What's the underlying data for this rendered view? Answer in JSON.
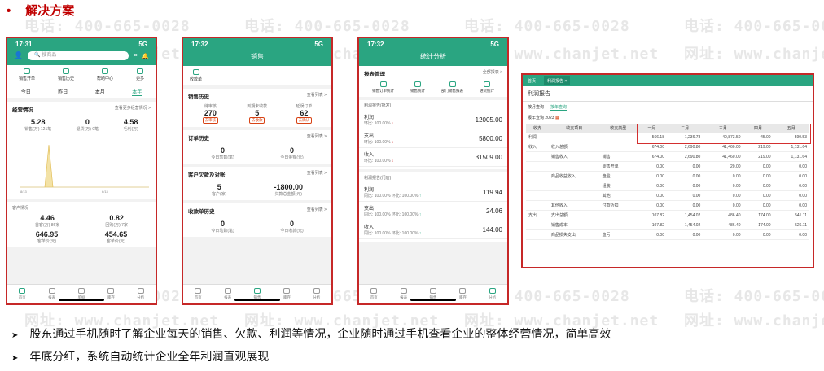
{
  "title": "解决方案",
  "bullets": [
    "股东通过手机随时了解企业每天的销售、欠款、利润等情况，企业随时通过手机查看企业的整体经营情况，简单高效",
    "年底分红，系统自动统计企业全年利润直观展现"
  ],
  "watermark": {
    "phone": "电话: 400-665-0028",
    "site": "网址: www.chanjet.net"
  },
  "p1": {
    "time": "17:31",
    "signal": "5G",
    "search": "搜商品",
    "quick": [
      "销售开单",
      "销售历史",
      "帮助中心",
      "更多"
    ],
    "tabs": [
      "今日",
      "昨日",
      "本月",
      "本年"
    ],
    "ops": {
      "title": "经营情况",
      "link": "查看更多经营情况 >",
      "items": [
        {
          "v": "5.28",
          "l": "销售(万) 121笔"
        },
        {
          "v": "0",
          "l": "退货(万) 0笔"
        },
        {
          "v": "4.58",
          "l": "毛利(万)"
        }
      ]
    },
    "xticks": [
      "8/13",
      "",
      "",
      "",
      "",
      "6/13",
      ""
    ],
    "cust": {
      "title": "客户情况",
      "items": [
        {
          "v": "4.46",
          "l": "首客(万) 86家"
        },
        {
          "v": "0.82",
          "l": "回购(万) 7家"
        },
        {
          "v": "646.95",
          "l": "客单价(元)"
        },
        {
          "v": "454.65",
          "l": "客单价(元)"
        }
      ]
    },
    "tabbar": [
      "首页",
      "报表",
      "单据",
      "库存",
      "分析"
    ]
  },
  "p2": {
    "time": "17:32",
    "signal": "5G",
    "header": "销售",
    "scan": "收款单",
    "sales": {
      "title": "销售历史",
      "link": "查看列表 >",
      "items": [
        {
          "l": "待审核",
          "v": "270",
          "t": "去审核"
        },
        {
          "l": "到期未收款",
          "v": "5",
          "t": "去收款"
        },
        {
          "l": "延误订单",
          "v": "62",
          "t": "去确认"
        }
      ]
    },
    "orders": {
      "title": "订单历史",
      "link": "查看列表 >",
      "items": [
        {
          "v": "0",
          "l": "今日笔数(笔)"
        },
        {
          "v": "0",
          "l": "今日金额(元)"
        }
      ]
    },
    "debt": {
      "title": "客户欠款及对账",
      "link": "查看列表 >",
      "items": [
        {
          "v": "5",
          "l": "客户(家)"
        },
        {
          "v": "-1800.00",
          "l": "欠款总金额(元)"
        }
      ]
    },
    "recv": {
      "title": "收款单历史",
      "link": "查看列表 >",
      "items": [
        {
          "v": "0",
          "l": "今日笔数(笔)"
        },
        {
          "v": "0",
          "l": "今日收款(元)"
        }
      ]
    },
    "tabbar": [
      "首页",
      "报表",
      "销售",
      "库存",
      "分析"
    ]
  },
  "p3": {
    "time": "17:32",
    "signal": "5G",
    "header": "统计分析",
    "mgmt": {
      "title": "报表管理",
      "link": "全部报表 >",
      "items": [
        "销售订单统计",
        "销售统计",
        "部门销售报表",
        "进货统计"
      ]
    },
    "profit": {
      "title": "利润报告(批发)",
      "rows": [
        {
          "n": "利润",
          "s": "环比: 100.00%",
          "v": "12005.00"
        },
        {
          "n": "支出",
          "s": "环比: 100.00%",
          "v": "5800.00"
        },
        {
          "n": "收入",
          "s": "环比: 100.00%",
          "v": "31509.00"
        }
      ]
    },
    "store": {
      "title": "利润报告(门店)",
      "rows": [
        {
          "n": "利润",
          "s": "同比: 100.00% 环比: 100.00%",
          "v": "119.94"
        },
        {
          "n": "支出",
          "s": "同比: 100.00% 环比: 100.00%",
          "v": "24.06"
        },
        {
          "n": "收入",
          "s": "同比: 100.00% 环比: 100.00%",
          "v": "144.00"
        }
      ]
    },
    "tabbar": [
      "首页",
      "报表",
      "销售",
      "库存",
      "分析"
    ]
  },
  "rep": {
    "tabs": [
      "首页",
      "利润报告 ×"
    ],
    "title": "利润报告",
    "sub": [
      "按月查询",
      "按年查询"
    ],
    "year": "报年查询  2023",
    "cols": [
      "收支",
      "收支项目",
      "收支类型",
      "一月",
      "二月",
      "三月",
      "四月",
      "五月"
    ],
    "rows": [
      [
        "利润",
        "",
        "",
        "566.18",
        "1,236.78",
        "40,873.50",
        "45.00",
        "590.53"
      ],
      [
        "收入",
        "收入总额",
        "",
        "674.00",
        "2,690.80",
        "41,460.00",
        "219.00",
        "1,131.64"
      ],
      [
        "",
        "销售收入",
        "销售",
        "674.00",
        "2,690.80",
        "41,460.00",
        "219.00",
        "1,131.64"
      ],
      [
        "",
        "",
        "零售开单",
        "0.00",
        "0.00",
        "20.00",
        "0.00",
        "0.00"
      ],
      [
        "",
        "商品收益收入",
        "盘盈",
        "0.00",
        "0.00",
        "0.00",
        "0.00",
        "0.00"
      ],
      [
        "",
        "",
        "组装",
        "0.00",
        "0.00",
        "0.00",
        "0.00",
        "0.00"
      ],
      [
        "",
        "",
        "其他",
        "0.00",
        "0.00",
        "0.00",
        "0.00",
        "0.00"
      ],
      [
        "",
        "其他收入",
        "付款折扣",
        "0.00",
        "0.00",
        "0.00",
        "0.00",
        "0.00"
      ],
      [
        "支出",
        "支出总额",
        "",
        "107.82",
        "1,454.02",
        "486.40",
        "174.00",
        "541.11"
      ],
      [
        "",
        "销售成本",
        "",
        "107.82",
        "1,454.02",
        "486.40",
        "174.00",
        "526.11"
      ],
      [
        "",
        "商品损失支出",
        "盘亏",
        "0.00",
        "0.00",
        "0.00",
        "0.00",
        "0.00"
      ]
    ]
  }
}
